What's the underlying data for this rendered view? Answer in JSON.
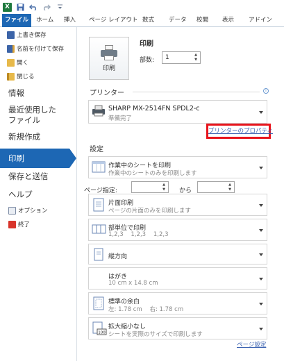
{
  "app": {
    "name": "Microsoft Excel 2010"
  },
  "qat": {
    "icons": [
      "excel-logo-icon",
      "save-icon",
      "undo-icon",
      "redo-icon",
      "customize-icon"
    ],
    "logo_letter": "X"
  },
  "ribbon": {
    "tabs": [
      "ファイル",
      "ホーム",
      "挿入",
      "ページ レイアウト",
      "数式",
      "データ",
      "校閲",
      "表示",
      "アドイン"
    ],
    "active_color": "#1d67b4"
  },
  "nav": {
    "small_items": [
      {
        "label": "上書き保存",
        "icon": "save-icon"
      },
      {
        "label": "名前を付けて保存",
        "icon": "save-as-icon"
      },
      {
        "label": "開く",
        "icon": "open-folder-icon"
      },
      {
        "label": "閉じる",
        "icon": "close-folder-icon"
      }
    ],
    "big_items": [
      "情報",
      "最近使用した\nファイル",
      "新規作成",
      "印刷",
      "保存と送信",
      "ヘルプ"
    ],
    "selected": "印刷",
    "bottom_items": [
      {
        "label": "オプション",
        "icon": "options-icon"
      },
      {
        "label": "終了",
        "icon": "exit-icon"
      }
    ]
  },
  "print": {
    "button_label": "印刷",
    "title": "印刷",
    "copies_label": "部数:",
    "copies_value": "1"
  },
  "printer": {
    "section_title": "プリンター",
    "name": "SHARP MX-2514FN SPDL2-c",
    "status": "準備完了",
    "properties_link": "プリンターのプロパティ",
    "highlight_color": "#e8141c"
  },
  "settings": {
    "section_title": "設定",
    "what_to_print": {
      "title": "作業中のシートを印刷",
      "subtitle": "作業中のシートのみを印刷します"
    },
    "pages_label": "ページ指定:",
    "pages_to": "から",
    "sides": {
      "title": "片面印刷",
      "subtitle": "ページの片面のみを印刷します"
    },
    "collation": {
      "title": "部単位で印刷",
      "subtitle": "1,2,3    1,2,3    1,2,3"
    },
    "orientation": {
      "title": "縦方向"
    },
    "paper": {
      "title": "はがき",
      "subtitle": "10 cm x 14.8 cm"
    },
    "margins": {
      "title": "標準の余白",
      "subtitle": "左: 1.78 cm    右: 1.78 cm"
    },
    "scaling": {
      "title": "拡大縮小なし",
      "subtitle": "シートを実際のサイズで印刷します",
      "icon_badge": "100"
    },
    "page_setup_link": "ページ設定"
  }
}
